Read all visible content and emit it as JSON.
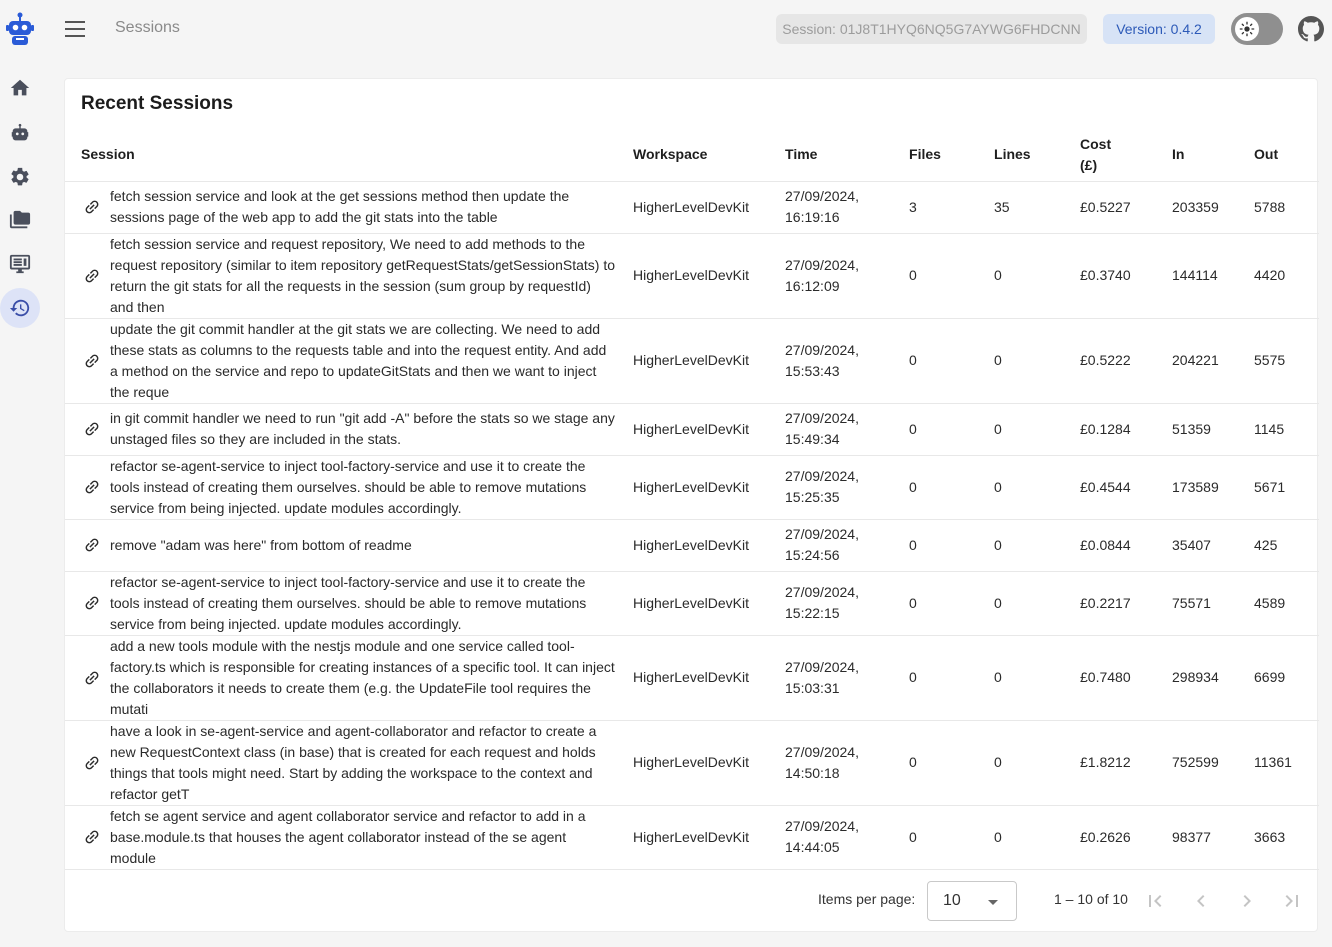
{
  "topbar": {
    "page_title": "Sessions",
    "session_label": "Session: 01J8T1HYQ6NQ5G7AYWG6FHDCNN",
    "version_label": "Version: 0.4.2"
  },
  "sidebar": {
    "items": [
      {
        "icon": "home-icon"
      },
      {
        "icon": "robot-icon"
      },
      {
        "icon": "gear-icon"
      },
      {
        "icon": "folders-icon"
      },
      {
        "icon": "monitor-icon"
      },
      {
        "icon": "history-icon",
        "active": true
      }
    ]
  },
  "card": {
    "title": "Recent Sessions",
    "columns": [
      "Session",
      "Workspace",
      "Time",
      "Files",
      "Lines",
      "Cost\n(£)",
      "In",
      "Out"
    ],
    "rows": [
      {
        "session": "fetch session service and look at the get sessions method then update the sessions page of the web app to add the git stats into the table",
        "workspace": "HigherLevelDevKit",
        "date": "27/09/2024,",
        "time": "16:19:16",
        "files": "3",
        "lines": "35",
        "cost": "£0.5227",
        "in": "203359",
        "out": "5788"
      },
      {
        "session": "fetch session service and request repository, We need to add methods to the request repository (similar to item repository getRequestStats/getSessionStats) to return the git stats for all the requests in the session (sum group by requestId) and then",
        "workspace": "HigherLevelDevKit",
        "date": "27/09/2024,",
        "time": "16:12:09",
        "files": "0",
        "lines": "0",
        "cost": "£0.3740",
        "in": "144114",
        "out": "4420"
      },
      {
        "session": "update the git commit handler at the git stats we are collecting. We need to add these stats as columns to the requests table and into the request entity. And add a method on the service and repo to updateGitStats and then we want to inject the reque",
        "workspace": "HigherLevelDevKit",
        "date": "27/09/2024,",
        "time": "15:53:43",
        "files": "0",
        "lines": "0",
        "cost": "£0.5222",
        "in": "204221",
        "out": "5575"
      },
      {
        "session": "in git commit handler we need to run \"git add -A\" before the stats so we stage any unstaged files so they are included in the stats.",
        "workspace": "HigherLevelDevKit",
        "date": "27/09/2024,",
        "time": "15:49:34",
        "files": "0",
        "lines": "0",
        "cost": "£0.1284",
        "in": "51359",
        "out": "1145"
      },
      {
        "session": "refactor se-agent-service to inject tool-factory-service and use it to create the tools instead of creating them ourselves. should be able to remove mutations service from being injected. update modules accordingly.",
        "workspace": "HigherLevelDevKit",
        "date": "27/09/2024,",
        "time": "15:25:35",
        "files": "0",
        "lines": "0",
        "cost": "£0.4544",
        "in": "173589",
        "out": "5671"
      },
      {
        "session": "remove \"adam was here\" from bottom of readme",
        "workspace": "HigherLevelDevKit",
        "date": "27/09/2024,",
        "time": "15:24:56",
        "files": "0",
        "lines": "0",
        "cost": "£0.0844",
        "in": "35407",
        "out": "425"
      },
      {
        "session": "refactor se-agent-service to inject tool-factory-service and use it to create the tools instead of creating them ourselves. should be able to remove mutations service from being injected. update modules accordingly.",
        "workspace": "HigherLevelDevKit",
        "date": "27/09/2024,",
        "time": "15:22:15",
        "files": "0",
        "lines": "0",
        "cost": "£0.2217",
        "in": "75571",
        "out": "4589"
      },
      {
        "session": "add a new tools module with the nestjs module and one service called tool-factory.ts which is responsible for creating instances of a specific tool. It can inject the collaborators it needs to create them (e.g. the UpdateFile tool requires the mutati",
        "workspace": "HigherLevelDevKit",
        "date": "27/09/2024,",
        "time": "15:03:31",
        "files": "0",
        "lines": "0",
        "cost": "£0.7480",
        "in": "298934",
        "out": "6699"
      },
      {
        "session": "have a look in se-agent-service and agent-collaborator and refactor to create a new RequestContext class (in base) that is created for each request and holds things that tools might need. Start by adding the workspace to the context and refactor getT",
        "workspace": "HigherLevelDevKit",
        "date": "27/09/2024,",
        "time": "14:50:18",
        "files": "0",
        "lines": "0",
        "cost": "£1.8212",
        "in": "752599",
        "out": "11361"
      },
      {
        "session": "fetch se agent service and agent collaborator service and refactor to add in a base.module.ts that houses the agent collaborator instead of the se agent module",
        "workspace": "HigherLevelDevKit",
        "date": "27/09/2024,",
        "time": "14:44:05",
        "files": "0",
        "lines": "0",
        "cost": "£0.2626",
        "in": "98377",
        "out": "3663"
      }
    ]
  },
  "paginator": {
    "items_per_page_label": "Items per page:",
    "page_size": "10",
    "range_label": "1 – 10 of 10"
  },
  "colors": {
    "accent": "#3a4ea8",
    "version_bg": "#d7e3f6",
    "version_fg": "#2d5ab8"
  }
}
